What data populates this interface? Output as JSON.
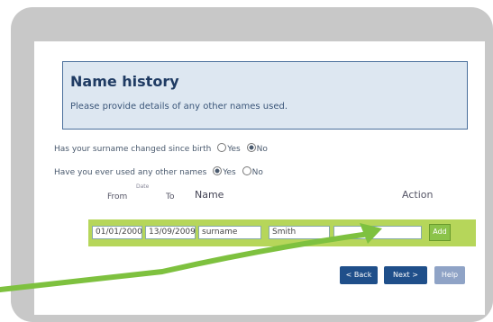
{
  "header": {
    "title": "Name history",
    "subtitle": "Please provide details of any other names used."
  },
  "questions": [
    {
      "text": "Has your surname changed since birth",
      "options": [
        "Yes",
        "No"
      ],
      "selected": "No"
    },
    {
      "text": "Have you ever used any other names",
      "options": [
        "Yes",
        "No"
      ],
      "selected": "Yes"
    }
  ],
  "table": {
    "headers": {
      "from": "From",
      "date_hint": "Date",
      "to": "To",
      "name": "Name",
      "action": "Action"
    },
    "row": {
      "from": "01/01/2000",
      "to": "13/09/2009",
      "type": "surname",
      "name": "Smith",
      "extra": "",
      "add_label": "Add"
    }
  },
  "buttons": {
    "back": "< Back",
    "next": "Next >",
    "help": "Help"
  },
  "colors": {
    "header_bg": "#dde7f1",
    "row_bg": "#b6d65a",
    "button_primary": "#1f4f8a",
    "arrow": "#7ec13f"
  }
}
